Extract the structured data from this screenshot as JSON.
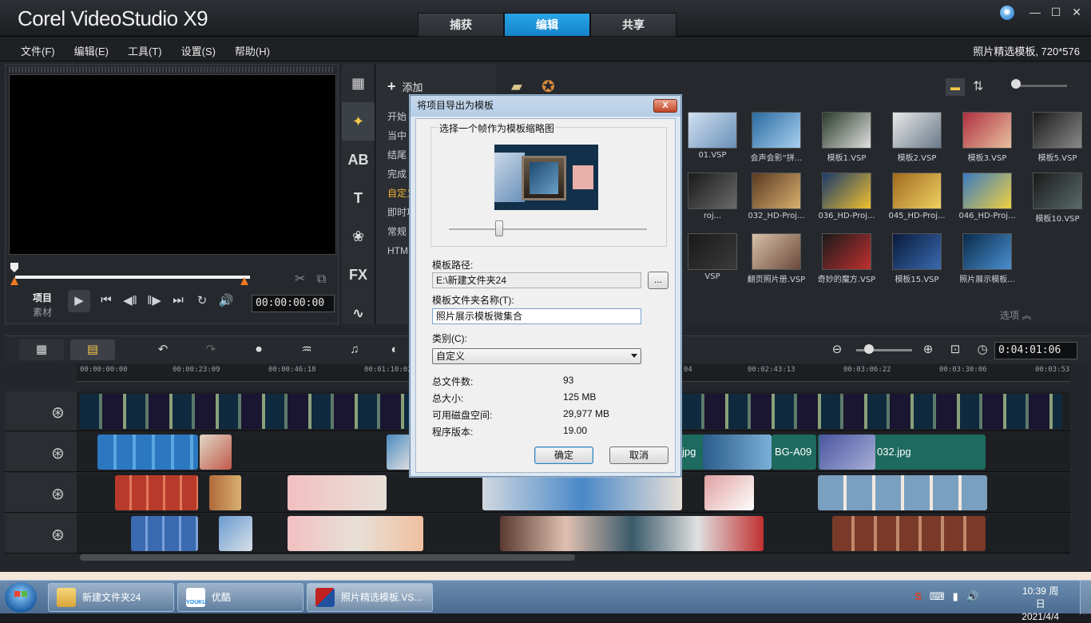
{
  "app": {
    "logo": "Corel VideoStudio X9",
    "tabs": [
      "捕获",
      "编辑",
      "共享"
    ],
    "active_tab": "编辑",
    "menu": [
      "文件(F)",
      "编辑(E)",
      "工具(T)",
      "设置(S)",
      "帮助(H)"
    ],
    "project_info": "照片精选模板, 720*576"
  },
  "preview": {
    "label_project": "项目",
    "label_clip": "素材",
    "timecode": "00:00:00:00"
  },
  "library": {
    "add_label": "添加",
    "categories": [
      "开始",
      "当中",
      "结尾",
      "完成",
      "自定义",
      "即时项目",
      "常规",
      "HTML5"
    ],
    "active_category": "自定义",
    "options_label": "选项",
    "templates": [
      "01.VSP",
      "会声会影“拼...",
      "模板1.VSP",
      "模板2.VSP",
      "模板3.VSP",
      "模板5.VSP",
      "roj...",
      "032_HD-Proj...",
      "036_HD-Proj...",
      "045_HD-Proj...",
      "046_HD-Proj...",
      "模板10.VSP",
      "VSP",
      "翻页照片册.VSP",
      "奇妙的魔方.VSP",
      "模板15.VSP",
      "照片展示模板..."
    ]
  },
  "timeline": {
    "timecode": "0:04:01:06",
    "ruler": [
      "00:00:00:00",
      "00:00:23:09",
      "00:00:46:18",
      "00:01:10:02",
      "04",
      "00:02:43:13",
      "00:03:06:22",
      "00:03:30:06",
      "00:03:53"
    ],
    "clips": [
      "jpg",
      "BG-A09",
      "032.jpg"
    ]
  },
  "dialog": {
    "title": "将项目导出为模板",
    "close": "X",
    "group_title": "选择一个帧作为模板缩略图",
    "path_label": "模板路径:",
    "path_value": "E:\\新建文件夹24",
    "browse": "...",
    "name_label": "模板文件夹名称(T):",
    "name_value": "照片展示模板微集合",
    "category_label": "类别(C):",
    "category_value": "自定义",
    "stats": [
      {
        "label": "总文件数:",
        "value": "93"
      },
      {
        "label": "总大小:",
        "value": "125 MB"
      },
      {
        "label": "可用磁盘空间:",
        "value": "29,977 MB"
      },
      {
        "label": "程序版本:",
        "value": "19.00"
      }
    ],
    "ok": "确定",
    "cancel": "取消"
  },
  "taskbar": {
    "items": [
      "新建文件夹24",
      "优酷",
      "照片精选模板.VS..."
    ],
    "youku_logo": "YOUKU",
    "time": "10:39 周日",
    "date": "2021/4/4"
  }
}
